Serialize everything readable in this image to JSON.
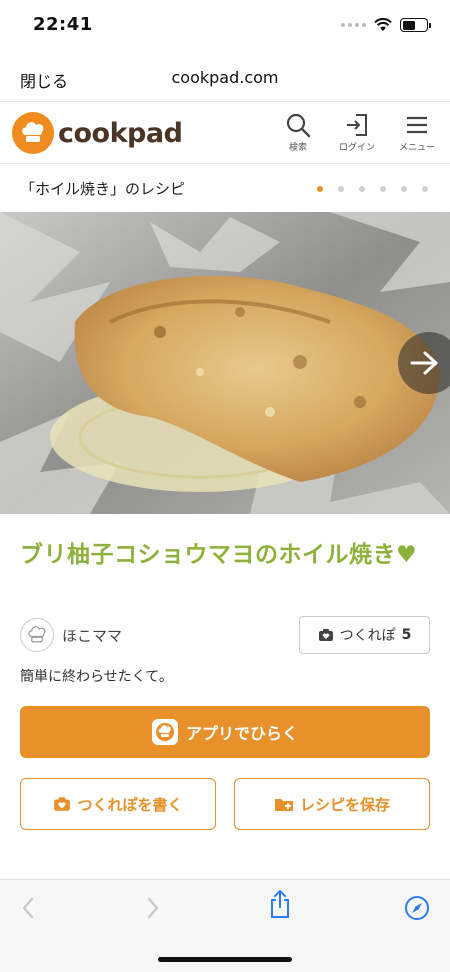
{
  "status_bar": {
    "time": "22:41"
  },
  "browser": {
    "close_label": "閉じる",
    "domain": "cookpad.com"
  },
  "header": {
    "logo_text": "cookpad",
    "nav": [
      {
        "label": "検索",
        "icon": "search-icon"
      },
      {
        "label": "ログイン",
        "icon": "login-icon"
      },
      {
        "label": "メニュー",
        "icon": "menu-icon"
      }
    ]
  },
  "subheader": {
    "title": "「ホイル焼き」のレシピ",
    "carousel_dots": 6,
    "active_dot": 0
  },
  "recipe": {
    "title": "ブリ柚子コショウマヨのホイル焼き♥",
    "author": "ほこママ",
    "tsukurepo_label": "つくれぽ",
    "tsukurepo_count": "5",
    "description": "簡単に終わらせたくて。"
  },
  "buttons": {
    "open_app": "アプリでひらく",
    "write_tsukurepo": "つくれぽを書く",
    "save_recipe": "レシピを保存"
  },
  "colors": {
    "brand_orange": "#e8912a",
    "title_green": "#8db13a",
    "logo_brown": "#4a3526"
  }
}
